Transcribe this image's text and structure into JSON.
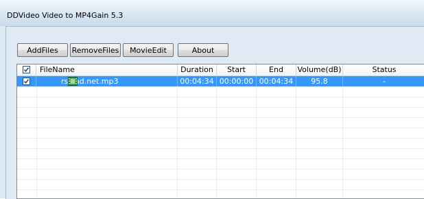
{
  "window": {
    "title": "DDVideo Video to MP4Gain 5.3"
  },
  "toolbar": {
    "buttons": [
      {
        "label": "AddFiles"
      },
      {
        "label": "RemoveFiles"
      },
      {
        "label": "MovieEdit"
      },
      {
        "label": "About"
      }
    ]
  },
  "list": {
    "header_checked": true,
    "columns": [
      "FileName",
      "Duration",
      "Start",
      "End",
      "Volume(dB)",
      "Status"
    ],
    "rows": [
      {
        "checked": true,
        "icon": "film-icon",
        "filename": "rsload.net.mp3",
        "duration": "00:04:34",
        "start": "00:00:00",
        "end": "00:04:34",
        "volume": "95.8",
        "status": "-",
        "selected": true
      }
    ]
  },
  "colors": {
    "selection": "#3399ff",
    "window_bg": "#dfeaf5"
  }
}
